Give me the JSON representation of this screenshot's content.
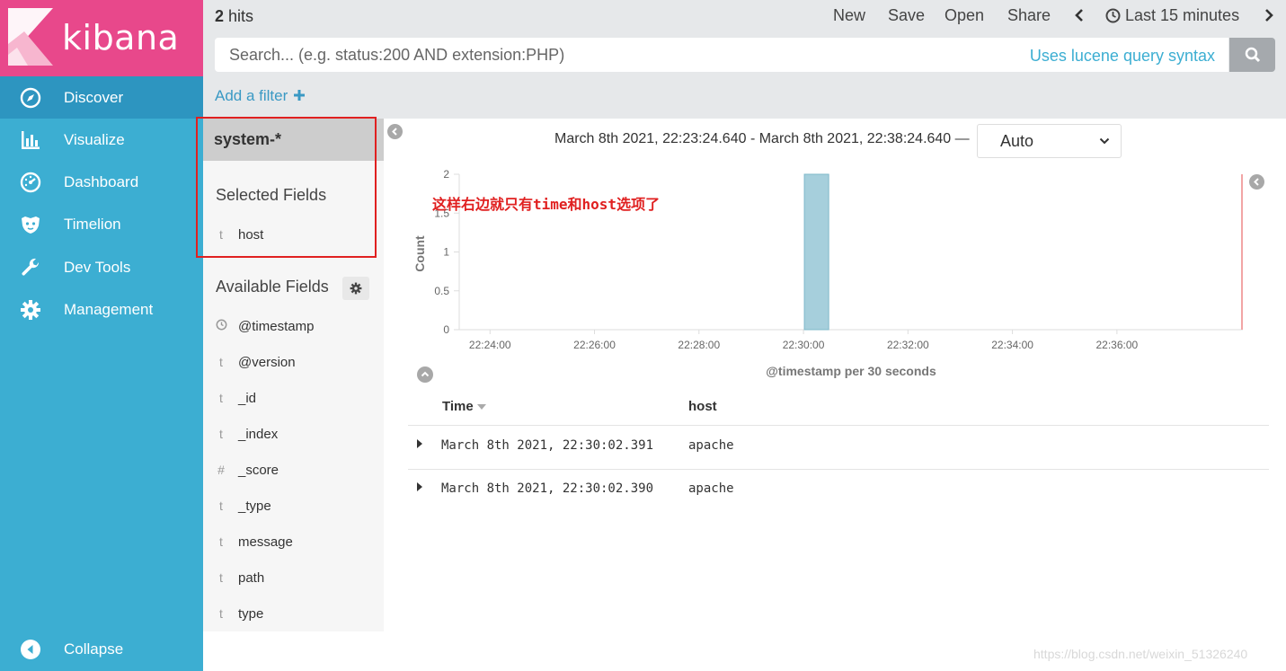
{
  "app": {
    "name": "kibana"
  },
  "nav": {
    "items": [
      {
        "label": "Discover",
        "icon": "compass-icon",
        "active": true
      },
      {
        "label": "Visualize",
        "icon": "bar-chart-icon",
        "active": false
      },
      {
        "label": "Dashboard",
        "icon": "gauge-icon",
        "active": false
      },
      {
        "label": "Timelion",
        "icon": "timelion-icon",
        "active": false
      },
      {
        "label": "Dev Tools",
        "icon": "wrench-icon",
        "active": false
      },
      {
        "label": "Management",
        "icon": "gear-icon",
        "active": false
      }
    ],
    "collapse_label": "Collapse"
  },
  "topbar": {
    "hits_count": "2",
    "hits_label": " hits",
    "menu": {
      "new": "New",
      "save": "Save",
      "open": "Open",
      "share": "Share",
      "time": "Last 15 minutes"
    },
    "search_placeholder": "Search... (e.g. status:200 AND extension:PHP)",
    "lucene_link": "Uses lucene query syntax",
    "add_filter": "Add a filter"
  },
  "fields_panel": {
    "index_pattern": "system-*",
    "selected_title": "Selected Fields",
    "selected": [
      {
        "type": "t",
        "name": "host"
      }
    ],
    "available_title": "Available Fields",
    "available": [
      {
        "type": "clock",
        "name": "@timestamp"
      },
      {
        "type": "t",
        "name": "@version"
      },
      {
        "type": "t",
        "name": "_id"
      },
      {
        "type": "t",
        "name": "_index"
      },
      {
        "type": "#",
        "name": "_score"
      },
      {
        "type": "t",
        "name": "_type"
      },
      {
        "type": "t",
        "name": "message"
      },
      {
        "type": "t",
        "name": "path"
      },
      {
        "type": "t",
        "name": "type"
      }
    ]
  },
  "histogram": {
    "time_range": "March 8th 2021, 22:23:24.640 - March 8th 2021, 22:38:24.640 —",
    "interval": "Auto",
    "annotation": "这样右边就只有time和host选项了"
  },
  "chart_data": {
    "type": "bar",
    "x": [
      "22:30:00"
    ],
    "values": [
      2
    ],
    "xticks": [
      "22:24:00",
      "22:26:00",
      "22:28:00",
      "22:30:00",
      "22:32:00",
      "22:34:00",
      "22:36:00"
    ],
    "yticks": [
      "0",
      "0.5",
      "1",
      "1.5",
      "2"
    ],
    "xlabel": "@timestamp per 30 seconds",
    "ylabel": "Count",
    "ylim": [
      0,
      2
    ],
    "bar_color": "#a6cfdc",
    "now_line_color": "#f2a5a5"
  },
  "table": {
    "headers": {
      "time": "Time",
      "host": "host"
    },
    "rows": [
      {
        "time": "March 8th 2021, 22:30:02.391",
        "host": "apache"
      },
      {
        "time": "March 8th 2021, 22:30:02.390",
        "host": "apache"
      }
    ]
  },
  "watermark": "https://blog.csdn.net/weixin_51326240"
}
